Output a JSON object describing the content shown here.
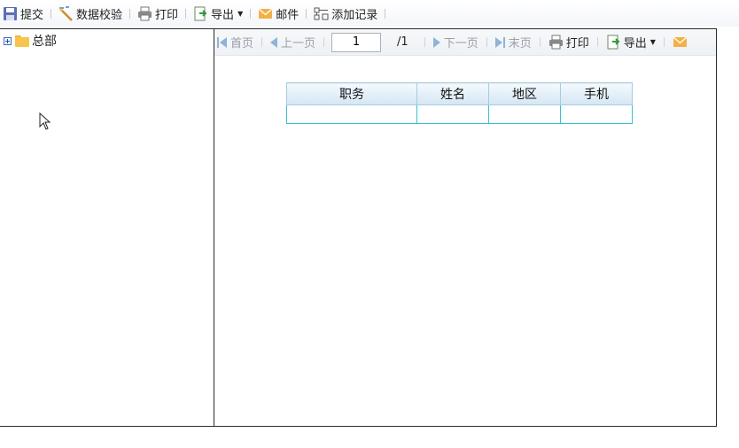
{
  "toolbar": {
    "items": [
      {
        "label": "提交",
        "icon": "save-icon"
      },
      {
        "label": "数据校验",
        "icon": "wand-icon"
      },
      {
        "label": "打印",
        "icon": "printer-icon"
      },
      {
        "label": "导出",
        "icon": "export-icon"
      },
      {
        "label": "邮件",
        "icon": "mail-icon"
      },
      {
        "label": "添加记录",
        "icon": "add-record-icon"
      }
    ]
  },
  "tree": {
    "root_label": "总部"
  },
  "pager": {
    "first": "首页",
    "prev": "上一页",
    "current_page": "1",
    "total": "/1",
    "next": "下一页",
    "last": "末页",
    "print": "打印",
    "export": "导出"
  },
  "table": {
    "headers": [
      "职务",
      "姓名",
      "地区",
      "手机"
    ],
    "rows": [
      [
        "",
        "",
        "",
        ""
      ]
    ]
  },
  "colors": {
    "accent": "#8fb3d8",
    "header_bg": "#d4e6f3",
    "cell_border": "#37c1cf"
  }
}
